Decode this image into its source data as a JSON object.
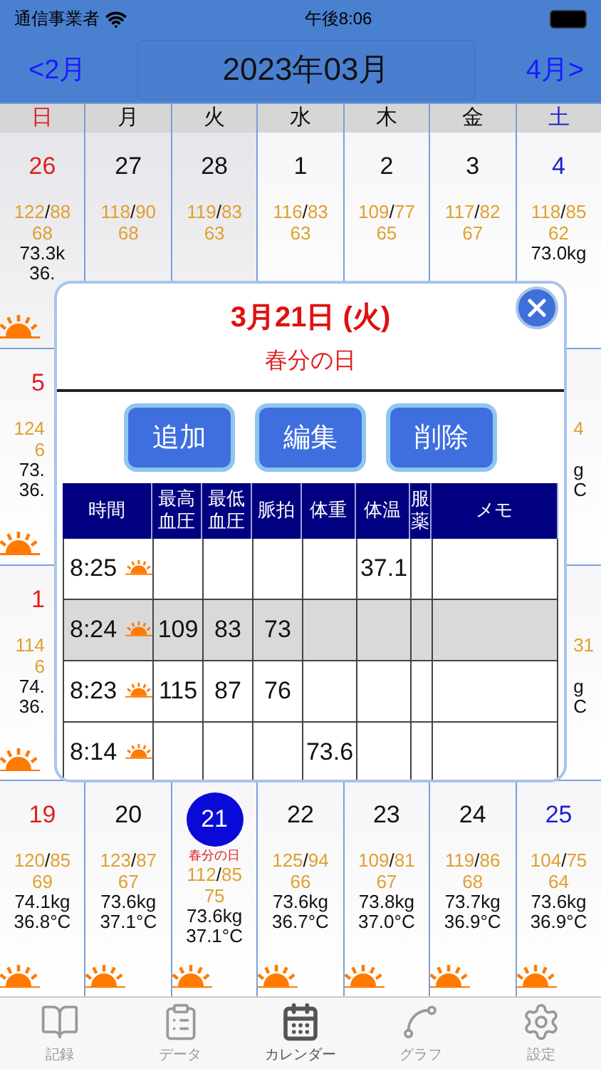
{
  "status_bar": {
    "carrier": "通信事業者",
    "time": "午後8:06"
  },
  "header": {
    "prev": "<2月",
    "title": "2023年03月",
    "next": "4月>"
  },
  "weekdays": [
    {
      "label": "日",
      "kind": "sun"
    },
    {
      "label": "月",
      "kind": "week"
    },
    {
      "label": "火",
      "kind": "week"
    },
    {
      "label": "水",
      "kind": "week"
    },
    {
      "label": "木",
      "kind": "week"
    },
    {
      "label": "金",
      "kind": "week"
    },
    {
      "label": "土",
      "kind": "sat"
    }
  ],
  "weeks": [
    {
      "cells": [
        {
          "kind": "day",
          "color": "#e02020",
          "date": "26",
          "other_month": true,
          "bp": "122/88",
          "pulse": "68",
          "weight": "73.3k",
          "temp": "36.",
          "sun": true
        },
        {
          "kind": "day",
          "color": "#111111",
          "date": "27",
          "other_month": true,
          "bp": "118/90",
          "pulse": "68"
        },
        {
          "kind": "day",
          "color": "#111111",
          "date": "28",
          "other_month": true,
          "bp": "119/83",
          "pulse": "63"
        },
        {
          "kind": "day",
          "color": "#111111",
          "date": "1",
          "other_month": false,
          "bp": "116/83",
          "pulse": "63"
        },
        {
          "kind": "day",
          "color": "#111111",
          "date": "2",
          "other_month": false,
          "bp": "109/77",
          "pulse": "65"
        },
        {
          "kind": "day",
          "color": "#111111",
          "date": "3",
          "other_month": false,
          "bp": "117/82",
          "pulse": "67"
        },
        {
          "kind": "day",
          "color": "#2020d0",
          "date": "4",
          "other_month": false,
          "bp": "118/85",
          "pulse": "62",
          "weight": "73.0kg"
        }
      ]
    },
    {
      "cells": [
        {
          "kind": "edge_left",
          "color": "#e02020",
          "date": "5",
          "bp": "124",
          "pulse": "6",
          "weight": "73.",
          "temp": "36.",
          "sun": true
        },
        {
          "kind": "covered"
        },
        {
          "kind": "covered"
        },
        {
          "kind": "covered"
        },
        {
          "kind": "covered"
        },
        {
          "kind": "covered"
        },
        {
          "kind": "edge_right",
          "bp": "4",
          "weight": "g",
          "temp": "C"
        }
      ]
    },
    {
      "cells": [
        {
          "kind": "edge_left",
          "color": "#e02020",
          "date": "1",
          "bp": "114",
          "pulse": "6",
          "weight": "74.",
          "temp": "36.",
          "sun": true
        },
        {
          "kind": "covered"
        },
        {
          "kind": "covered"
        },
        {
          "kind": "covered"
        },
        {
          "kind": "covered"
        },
        {
          "kind": "covered"
        },
        {
          "kind": "edge_right",
          "bp": "31",
          "weight": "g",
          "temp": "C"
        }
      ]
    },
    {
      "cells": [
        {
          "kind": "day",
          "color": "#e02020",
          "date": "19",
          "other_month": false,
          "bp": "120/85",
          "pulse": "69",
          "weight": "74.1kg",
          "temp": "36.8°C",
          "sun": true
        },
        {
          "kind": "day",
          "color": "#111111",
          "date": "20",
          "other_month": false,
          "bp": "123/87",
          "pulse": "67",
          "weight": "73.6kg",
          "temp": "37.1°C",
          "sun": true
        },
        {
          "kind": "day",
          "date": "21",
          "other_month": false,
          "selected": true,
          "holiday": "春分の日",
          "bp": "112/85",
          "pulse": "75",
          "weight": "73.6kg",
          "temp": "37.1°C",
          "sun": true
        },
        {
          "kind": "day",
          "color": "#111111",
          "date": "22",
          "other_month": false,
          "bp": "125/94",
          "pulse": "66",
          "weight": "73.6kg",
          "temp": "36.7°C",
          "sun": true
        },
        {
          "kind": "day",
          "color": "#111111",
          "date": "23",
          "other_month": false,
          "bp": "109/81",
          "pulse": "67",
          "weight": "73.8kg",
          "temp": "37.0°C",
          "sun": true
        },
        {
          "kind": "day",
          "color": "#111111",
          "date": "24",
          "other_month": false,
          "bp": "119/86",
          "pulse": "68",
          "weight": "73.7kg",
          "temp": "36.9°C",
          "sun": true
        },
        {
          "kind": "day",
          "color": "#2020d0",
          "date": "25",
          "other_month": false,
          "bp": "104/75",
          "pulse": "64",
          "weight": "73.6kg",
          "temp": "36.9°C",
          "sun": true
        }
      ]
    }
  ],
  "dialog": {
    "title": "3月21日 (火)",
    "holiday": "春分の日",
    "buttons": [
      "追加",
      "編集",
      "削除"
    ],
    "columns": [
      "時間",
      "最高血圧",
      "最低血圧",
      "脈拍",
      "体重",
      "体温",
      "服薬",
      "メモ"
    ],
    "rows": [
      {
        "selected": false,
        "sun": true,
        "cells": [
          "8:25",
          "",
          "",
          "",
          "",
          "37.1",
          "",
          ""
        ]
      },
      {
        "selected": true,
        "sun": true,
        "cells": [
          "8:24",
          "109",
          "83",
          "73",
          "",
          "",
          "",
          ""
        ]
      },
      {
        "selected": false,
        "sun": true,
        "cells": [
          "8:23",
          "115",
          "87",
          "76",
          "",
          "",
          "",
          ""
        ]
      },
      {
        "selected": false,
        "sun": true,
        "cells": [
          "8:14",
          "",
          "",
          "",
          "73.6",
          "",
          "",
          ""
        ]
      }
    ]
  },
  "tab_bar": [
    {
      "label": "記録",
      "selected": false
    },
    {
      "label": "データ",
      "selected": false
    },
    {
      "label": "カレンダー",
      "selected": true
    },
    {
      "label": "グラフ",
      "selected": false
    },
    {
      "label": "設定",
      "selected": false
    }
  ]
}
